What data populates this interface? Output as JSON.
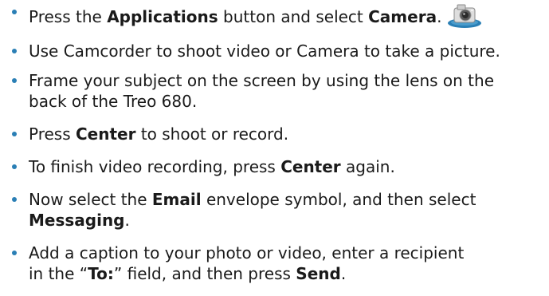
{
  "bullets": [
    {
      "parts": [
        {
          "t": "Press the "
        },
        {
          "t": "Applications",
          "b": true
        },
        {
          "t": " button and select "
        },
        {
          "t": "Camera",
          "b": true
        },
        {
          "t": "."
        }
      ],
      "icon": "camera-icon"
    },
    {
      "parts": [
        {
          "t": "Use Camcorder to shoot video or Camera to take a picture."
        }
      ]
    },
    {
      "parts": [
        {
          "t": "Frame your subject on the screen by using the lens on the"
        },
        {
          "t": "back of the Treo 680."
        }
      ]
    },
    {
      "parts": [
        {
          "t": "Press "
        },
        {
          "t": "Center",
          "b": true
        },
        {
          "t": " to shoot or record."
        }
      ]
    },
    {
      "parts": [
        {
          "t": "To finish video recording, press "
        },
        {
          "t": "Center",
          "b": true
        },
        {
          "t": " again."
        }
      ]
    },
    {
      "parts": [
        {
          "t": "Now select the "
        },
        {
          "t": "Email",
          "b": true
        },
        {
          "t": " envelope symbol, and then select"
        },
        {
          "t": "Messaging",
          "b": true
        },
        {
          "t": "."
        }
      ]
    },
    {
      "parts": [
        {
          "t": "Add a caption to your photo or video, enter a recipient"
        },
        {
          "t": "in the “"
        },
        {
          "t": "To:",
          "b": true
        },
        {
          "t": "” field, and then press "
        },
        {
          "t": "Send",
          "b": true
        },
        {
          "t": "."
        }
      ]
    }
  ],
  "colors": {
    "text": "#1a1a1a",
    "bullet": "#2a7fb5",
    "icon_body": "#d9d9d9",
    "icon_base": "#2a7fb5"
  }
}
